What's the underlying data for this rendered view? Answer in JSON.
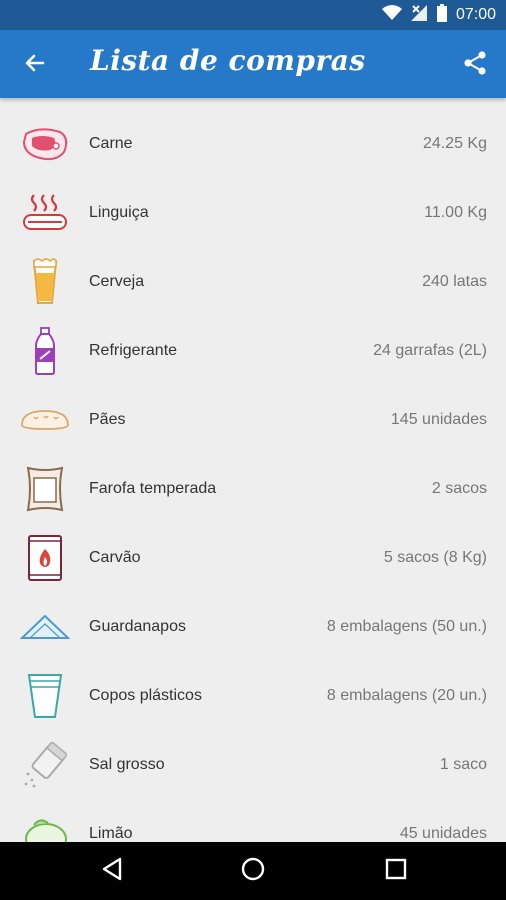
{
  "status_bar": {
    "time": "07:00",
    "icons": [
      "wifi-icon",
      "no-signal-icon",
      "battery-icon"
    ]
  },
  "app_bar": {
    "title": "Lista de compras",
    "back_icon": "arrow-back-icon",
    "share_icon": "share-icon",
    "color": "#2679c8"
  },
  "items": [
    {
      "name": "Carne",
      "quantity": "24.25 Kg",
      "icon": "meat-icon"
    },
    {
      "name": "Linguiça",
      "quantity": "11.00 Kg",
      "icon": "sausage-icon"
    },
    {
      "name": "Cerveja",
      "quantity": "240 latas",
      "icon": "beer-glass-icon"
    },
    {
      "name": "Refrigerante",
      "quantity": "24 garrafas (2L)",
      "icon": "soda-bottle-icon"
    },
    {
      "name": "Pães",
      "quantity": "145 unidades",
      "icon": "bread-icon"
    },
    {
      "name": "Farofa temperada",
      "quantity": "2 sacos",
      "icon": "bag-icon"
    },
    {
      "name": "Carvão",
      "quantity": "5 sacos (8 Kg)",
      "icon": "charcoal-bag-icon"
    },
    {
      "name": "Guardanapos",
      "quantity": "8 embalagens (50 un.)",
      "icon": "napkin-icon"
    },
    {
      "name": "Copos plásticos",
      "quantity": "8 embalagens (20 un.)",
      "icon": "plastic-cups-icon"
    },
    {
      "name": "Sal grosso",
      "quantity": "1 saco",
      "icon": "salt-shaker-icon"
    },
    {
      "name": "Limão",
      "quantity": "45 unidades",
      "icon": "lemon-icon"
    }
  ],
  "nav_bar": {
    "buttons": [
      "back-triangle-icon",
      "home-circle-icon",
      "recents-square-icon"
    ]
  }
}
